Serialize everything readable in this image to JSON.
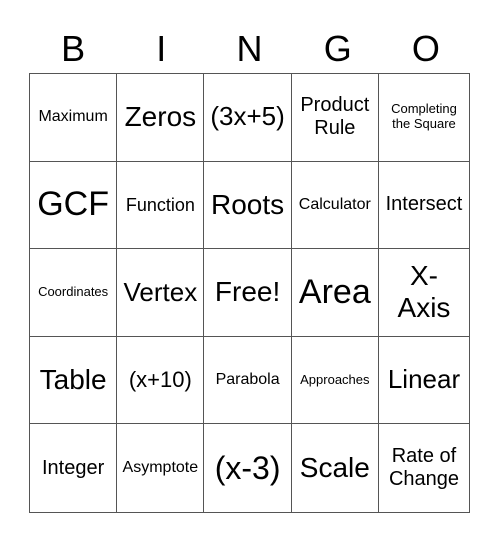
{
  "header": [
    "B",
    "I",
    "N",
    "G",
    "O"
  ],
  "cells": [
    "Maximum",
    "Zeros",
    "(3x+5)",
    "Product Rule",
    "Completing the Square",
    "GCF",
    "Function",
    "Roots",
    "Calculator",
    "Intersect",
    "Coordinates",
    "Vertex",
    "Free!",
    "Area",
    "X-Axis",
    "Table",
    "(x+10)",
    "Parabola",
    "Approaches",
    "Linear",
    "Integer",
    "Asymptote",
    "(x-3)",
    "Scale",
    "Rate of Change"
  ]
}
